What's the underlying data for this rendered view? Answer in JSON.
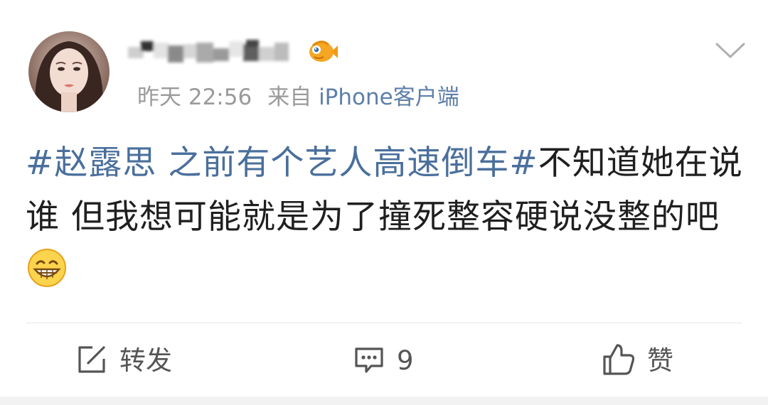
{
  "post": {
    "author_name": "晓…",
    "time": "昨天 22:56",
    "source_prefix": "来自",
    "source": "iPhone客户端",
    "topic": "#赵露思 之前有个艺人高速倒车#",
    "text": "不知道她在说谁 但我想可能就是为了撞死整容硬说没整的吧",
    "emoji": "grinning-face-emoji"
  },
  "actions": {
    "repost_label": "转发",
    "comment_count": "9",
    "like_label": "赞"
  },
  "icons": {
    "badge": "fish-badge-icon",
    "menu": "chevron-down-icon",
    "repost": "repost-icon",
    "comment": "comment-icon",
    "like": "thumbs-up-icon"
  },
  "colors": {
    "topic": "#4a6f9c",
    "source": "#5d7fa8",
    "meta": "#9a9a9a",
    "text": "#1f1f1f",
    "badge": "#f5a623"
  }
}
